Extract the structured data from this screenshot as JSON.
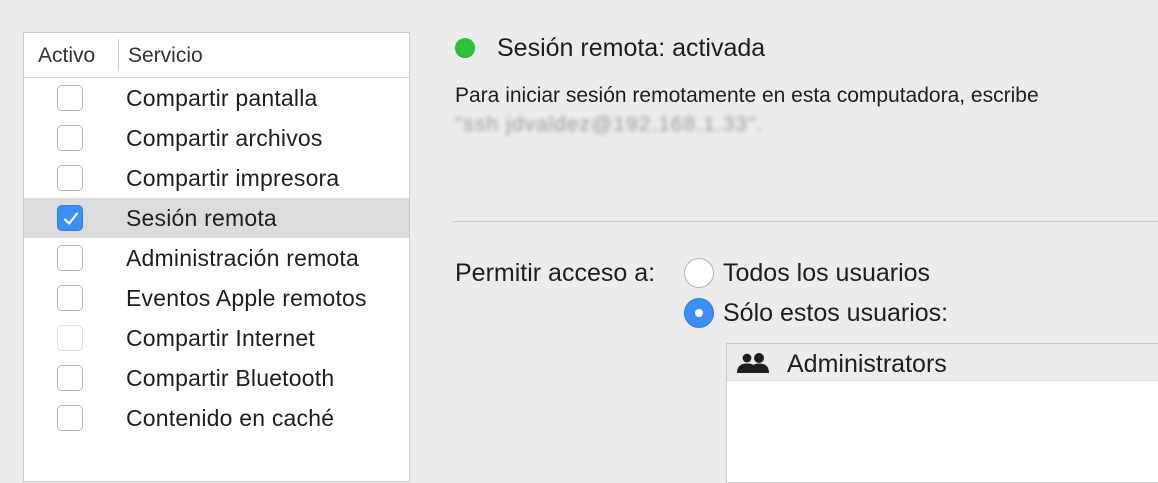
{
  "services": {
    "header": {
      "activo": "Activo",
      "servicio": "Servicio"
    },
    "items": [
      {
        "label": "Compartir pantalla",
        "checked": false,
        "enabled": true,
        "selected": false
      },
      {
        "label": "Compartir archivos",
        "checked": false,
        "enabled": true,
        "selected": false
      },
      {
        "label": "Compartir impresora",
        "checked": false,
        "enabled": true,
        "selected": false
      },
      {
        "label": "Sesión remota",
        "checked": true,
        "enabled": true,
        "selected": true
      },
      {
        "label": "Administración remota",
        "checked": false,
        "enabled": true,
        "selected": false
      },
      {
        "label": "Eventos Apple remotos",
        "checked": false,
        "enabled": true,
        "selected": false
      },
      {
        "label": "Compartir Internet",
        "checked": false,
        "enabled": false,
        "selected": false
      },
      {
        "label": "Compartir Bluetooth",
        "checked": false,
        "enabled": true,
        "selected": false
      },
      {
        "label": "Contenido en caché",
        "checked": false,
        "enabled": true,
        "selected": false
      }
    ]
  },
  "status": {
    "text": "Sesión remota: activada",
    "color": "#2fc33b",
    "instructions": "Para iniciar sesión remotamente en esta computadora, escribe",
    "masked_command": "\"ssh jdvaldez@192.168.1.33\"."
  },
  "access": {
    "label": "Permitir acceso a:",
    "options": [
      {
        "label": "Todos los usuarios",
        "selected": false
      },
      {
        "label": "Sólo estos usuarios:",
        "selected": true
      }
    ],
    "users": [
      {
        "name": "Administrators",
        "icon": "group-icon"
      }
    ]
  },
  "colors": {
    "accent": "#3d8ef7",
    "selection": "#dcdcdc"
  }
}
